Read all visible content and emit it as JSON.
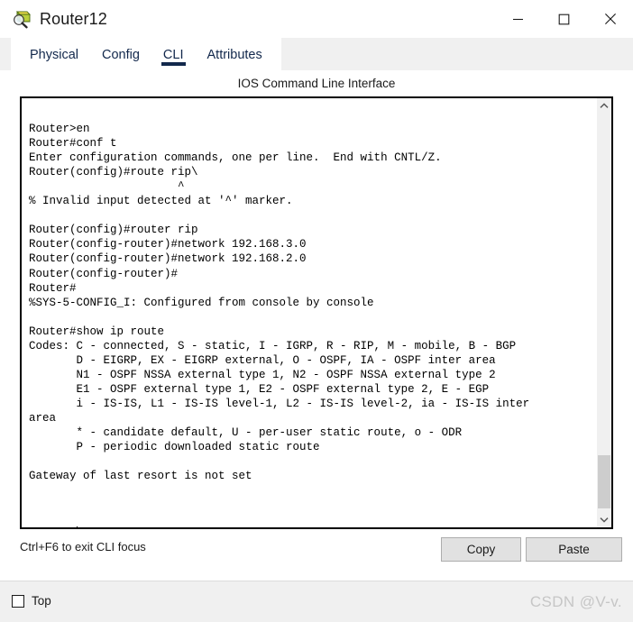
{
  "window": {
    "title": "Router12",
    "icon": "router-magnifier-icon",
    "controls": {
      "minimize": "minimize-icon",
      "maximize": "maximize-icon",
      "close": "close-icon"
    }
  },
  "tabs": [
    {
      "label": "Physical",
      "active": false
    },
    {
      "label": "Config",
      "active": false
    },
    {
      "label": "CLI",
      "active": true
    },
    {
      "label": "Attributes",
      "active": false
    }
  ],
  "panel": {
    "title": "IOS Command Line Interface"
  },
  "terminal": {
    "lines": [
      "",
      "Router>en",
      "Router#conf t",
      "Enter configuration commands, one per line.  End with CNTL/Z.",
      "Router(config)#route rip\\",
      "                      ^",
      "% Invalid input detected at '^' marker.",
      "",
      "Router(config)#router rip",
      "Router(config-router)#network 192.168.3.0",
      "Router(config-router)#network 192.168.2.0",
      "Router(config-router)#",
      "Router#",
      "%SYS-5-CONFIG_I: Configured from console by console",
      "",
      "Router#show ip route",
      "Codes: C - connected, S - static, I - IGRP, R - RIP, M - mobile, B - BGP",
      "       D - EIGRP, EX - EIGRP external, O - OSPF, IA - OSPF inter area",
      "       N1 - OSPF NSSA external type 1, N2 - OSPF NSSA external type 2",
      "       E1 - OSPF external type 1, E2 - OSPF external type 2, E - EGP",
      "       i - IS-IS, L1 - IS-IS level-1, L2 - IS-IS level-2, ia - IS-IS inter",
      "area",
      "       * - candidate default, U - per-user static route, o - ODR",
      "       P - periodic downloaded static route",
      "",
      "Gateway of last resort is not set",
      "",
      "",
      ""
    ],
    "prompt": "Router#",
    "scrollbar": {
      "up_arrow": "chevron-up-icon",
      "down_arrow": "chevron-down-icon"
    }
  },
  "footer": {
    "hint": "Ctrl+F6 to exit CLI focus",
    "copy_label": "Copy",
    "paste_label": "Paste"
  },
  "statusbar": {
    "top_label": "Top",
    "top_checked": false,
    "watermark": "CSDN @V-v."
  },
  "colors": {
    "tab_accent": "#12284c",
    "panel_bg": "#ffffff",
    "chrome_bg": "#f0f0f0",
    "button_face": "#e1e1e1",
    "scrollbar_thumb": "#cdcdcd",
    "watermark": "#c6c6c6"
  }
}
